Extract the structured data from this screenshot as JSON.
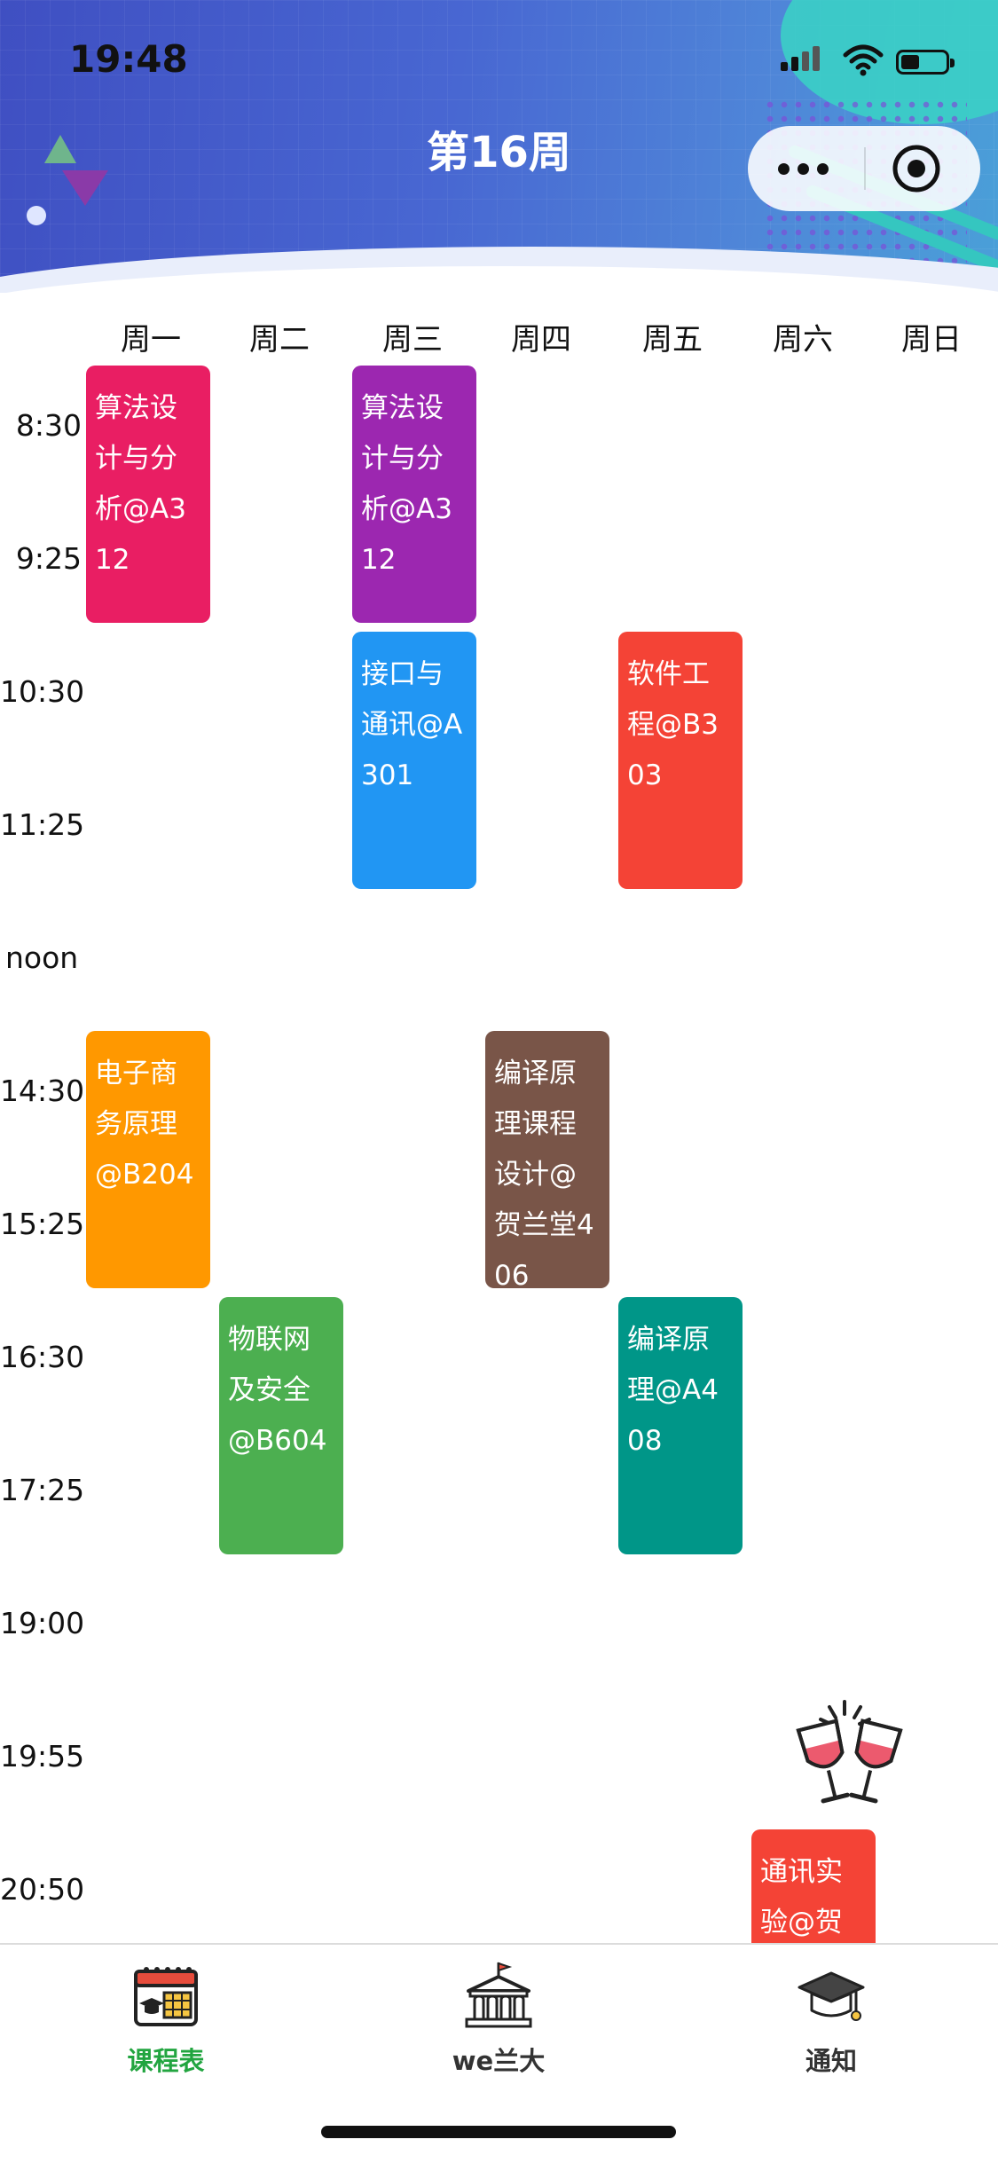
{
  "status_bar": {
    "time": "19:48"
  },
  "header": {
    "title": "第16周"
  },
  "days": [
    "周一",
    "周二",
    "周三",
    "周四",
    "周五",
    "周六",
    "周日"
  ],
  "times": [
    "8:30",
    "9:25",
    "10:30",
    "11:25",
    "noon",
    "14:30",
    "15:25",
    "16:30",
    "17:25",
    "19:00",
    "19:55",
    "20:50"
  ],
  "courses": [
    {
      "text": "算法设计与分析@A312",
      "color": "#e91e63"
    },
    {
      "text": "算法设计与分析@A312",
      "color": "#9c27b0"
    },
    {
      "text": "接口与通讯@A301",
      "color": "#2196f3"
    },
    {
      "text": "软件工程@B303",
      "color": "#f44336"
    },
    {
      "text": "电子商务原理@B204",
      "color": "#ff9800"
    },
    {
      "text": "编译原理课程设计@贺兰堂406",
      "color": "#795548"
    },
    {
      "text": "物联网及安全@B604",
      "color": "#4caf50"
    },
    {
      "text": "编译原理@A408",
      "color": "#009688"
    },
    {
      "text": "通讯实验@贺兰",
      "color": "#f44336"
    }
  ],
  "tabbar": {
    "items": [
      {
        "label": "课程表",
        "icon": "calendar-icon",
        "active": true
      },
      {
        "label": "we兰大",
        "icon": "university-building-icon",
        "active": false
      },
      {
        "label": "通知",
        "icon": "graduation-cap-icon",
        "active": false
      }
    ],
    "active_color": "#22a540"
  }
}
